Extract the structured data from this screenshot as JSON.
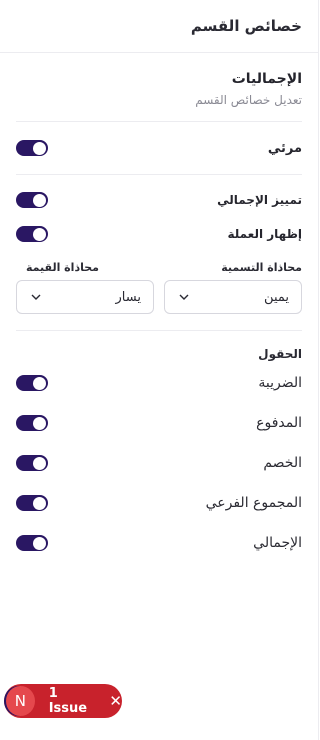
{
  "header": {
    "title": "خصائص القسم"
  },
  "totals": {
    "title": "الإجماليات",
    "subtitle": "تعديل خصائص القسم",
    "visible_label": "مرئي",
    "highlight_total_label": "تمييز الإجمالي",
    "show_currency_label": "إظهار العملة",
    "label_alignment_label": "محاذاة التسمية",
    "value_alignment_label": "محاذاة القيمة",
    "label_alignment_value": "يمين",
    "value_alignment_value": "يسار"
  },
  "toggles": {
    "visible": true,
    "highlight_total": true,
    "show_currency": true
  },
  "fields": {
    "title": "الحقول",
    "items": [
      {
        "label": "الضريبة",
        "enabled": true
      },
      {
        "label": "المدفوع",
        "enabled": true
      },
      {
        "label": "الخصم",
        "enabled": true
      },
      {
        "label": "المجموع الفرعي",
        "enabled": true
      },
      {
        "label": "الإجمالي",
        "enabled": true
      }
    ]
  },
  "issue_badge": {
    "avatar_letter": "N",
    "text": "1 Issue",
    "close": "✕"
  },
  "colors": {
    "accent": "#2a1763",
    "issue_red": "#c8222c",
    "avatar_red": "#e5484d"
  }
}
